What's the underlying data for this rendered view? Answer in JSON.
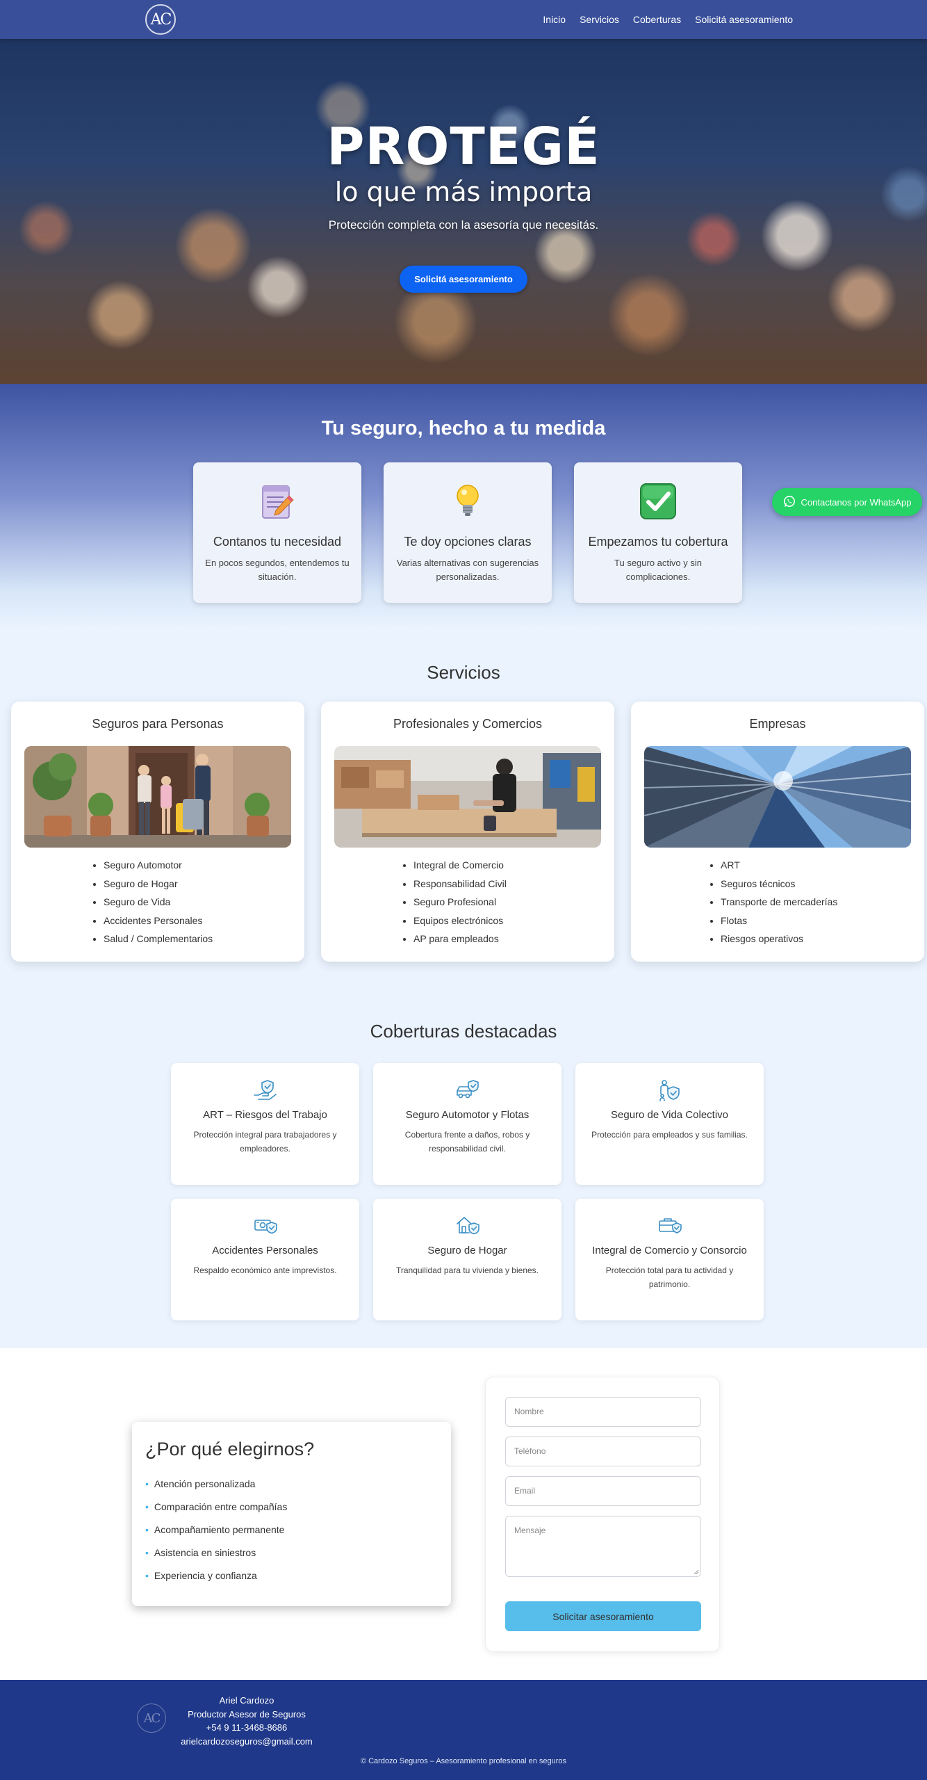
{
  "nav": {
    "logo_text": "AC",
    "links": [
      "Inicio",
      "Servicios",
      "Coberturas",
      "Solicitá asesoramiento"
    ]
  },
  "hero": {
    "title": "PROTEGÉ",
    "subtitle": "lo que más importa",
    "tagline": "Protección completa con la asesoría que necesitás.",
    "cta": "Solicitá asesoramiento"
  },
  "steps": {
    "title": "Tu seguro, hecho a tu medida",
    "items": [
      {
        "icon": "memo-icon",
        "title": "Contanos tu necesidad",
        "text": "En pocos segundos, entendemos tu situación."
      },
      {
        "icon": "lightbulb-icon",
        "title": "Te doy opciones claras",
        "text": "Varias alternativas con sugerencias personalizadas."
      },
      {
        "icon": "check-mark-icon",
        "title": "Empezamos tu cobertura",
        "text": "Tu seguro activo y sin complicaciones."
      }
    ]
  },
  "whatsapp": {
    "label": "Contactanos por WhatsApp",
    "color": "#25d366"
  },
  "services": {
    "title": "Servicios",
    "cards": [
      {
        "title": "Seguros para Personas",
        "image": "family-photo",
        "items": [
          "Seguro Automotor",
          "Seguro de Hogar",
          "Seguro de Vida",
          "Accidentes Personales",
          "Salud / Complementarios"
        ]
      },
      {
        "title": "Profesionales y Comercios",
        "image": "workshop-photo",
        "items": [
          "Integral de Comercio",
          "Responsabilidad Civil",
          "Seguro Profesional",
          "Equipos electrónicos",
          "AP para empleados"
        ]
      },
      {
        "title": "Empresas",
        "image": "skyscrapers-photo",
        "items": [
          "ART",
          "Seguros técnicos",
          "Transporte de mercaderías",
          "Flotas",
          "Riesgos operativos"
        ]
      }
    ]
  },
  "coverages": {
    "title": "Coberturas destacadas",
    "cards": [
      {
        "icon": "hand-shield-icon",
        "title": "ART – Riesgos del Trabajo",
        "text": "Protección integral para trabajadores y empleadores."
      },
      {
        "icon": "car-shield-icon",
        "title": "Seguro Automotor y Flotas",
        "text": "Cobertura frente a daños, robos y responsabilidad civil."
      },
      {
        "icon": "people-shield-icon",
        "title": "Seguro de Vida Colectivo",
        "text": "Protección para empleados y sus familias."
      },
      {
        "icon": "money-shield-icon",
        "title": "Accidentes Personales",
        "text": "Respaldo económico ante imprevistos."
      },
      {
        "icon": "house-shield-icon",
        "title": "Seguro de Hogar",
        "text": "Tranquilidad para tu vivienda y bienes."
      },
      {
        "icon": "briefcase-shield-icon",
        "title": "Integral de Comercio y Consorcio",
        "text": "Protección total para tu actividad y patrimonio."
      }
    ]
  },
  "why": {
    "title": "¿Por qué elegirnos?",
    "items": [
      "Atención personalizada",
      "Comparación entre compañías",
      "Acompañamiento permanente",
      "Asistencia en siniestros",
      "Experiencia y confianza"
    ]
  },
  "form": {
    "name_placeholder": "Nombre",
    "phone_placeholder": "Teléfono",
    "email_placeholder": "Email",
    "message_placeholder": "Mensaje",
    "submit": "Solicitar asesoramiento"
  },
  "footer": {
    "logo_text": "AC",
    "name": "Ariel Cardozo",
    "role": "Productor Asesor de Seguros",
    "phone": "+54 9 11-3468-8686",
    "email": "arielcardozoseguros@gmail.com",
    "copyright": "© Cardozo Seguros – Asesoramiento profesional en seguros"
  },
  "colors": {
    "nav": "#394f9a",
    "accent": "#0d63f2",
    "button": "#57bdea",
    "footer": "#1f3889"
  }
}
